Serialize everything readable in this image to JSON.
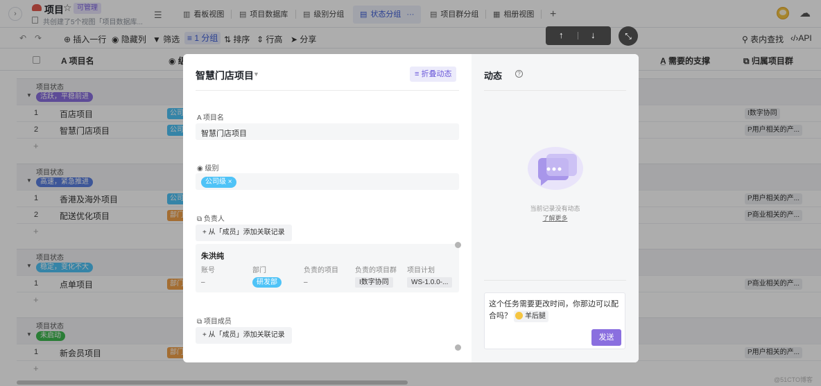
{
  "app": {
    "title": "项目",
    "badge": "可管理",
    "description": "共创建了5个视图「项目数据库...",
    "views": [
      {
        "label": "看板视图"
      },
      {
        "label": "项目数据库"
      },
      {
        "label": "级别分组"
      },
      {
        "label": "状态分组"
      },
      {
        "label": "项目群分组"
      },
      {
        "label": "相册视图"
      }
    ]
  },
  "toolbar": {
    "insert_row": "插入一行",
    "hide_cols": "隐藏列",
    "filter": "筛选",
    "group": "1 分组",
    "sort": "排序",
    "row_height": "行高",
    "share": "分享",
    "find": "表内查找",
    "api": "API"
  },
  "table": {
    "headers": {
      "name": "项目名",
      "level": "级",
      "support": "需要的支撑",
      "project_group": "归属项目群"
    },
    "group_label": "项目状态",
    "groups": [
      {
        "status": "活跃，平稳前进",
        "color": "#8a6fdf",
        "rows": [
          {
            "num": "1",
            "name": "百店项目",
            "level": "公司级",
            "level_color": "#4fc3f7",
            "pg": "I数字协同"
          },
          {
            "num": "2",
            "name": "智慧门店项目",
            "level": "公司级",
            "level_color": "#4fc3f7",
            "pg": "P用户相关的产..."
          }
        ]
      },
      {
        "status": "高速，紧急推进",
        "color": "#5b7fe0",
        "rows": [
          {
            "num": "1",
            "name": "香港及海外项目",
            "level": "公司级",
            "level_color": "#4fc3f7",
            "pg": "P用户相关的产..."
          },
          {
            "num": "2",
            "name": "配送优化项目",
            "level": "部门级",
            "level_color": "#f0a14a",
            "pg": "P商业相关的产..."
          }
        ]
      },
      {
        "status": "稳定，变化不大",
        "color": "#4fc3f7",
        "rows": [
          {
            "num": "1",
            "name": "点单项目",
            "level": "部门级",
            "level_color": "#f0a14a",
            "pg": "P商业相关的产..."
          }
        ]
      },
      {
        "status": "未启动",
        "color": "#3fb950",
        "rows": [
          {
            "num": "1",
            "name": "新会员项目",
            "level": "部门级",
            "level_color": "#f0a14a",
            "pg": "P用户相关的产..."
          }
        ]
      }
    ]
  },
  "modal": {
    "title": "智慧门店项目",
    "fold_btn": "折叠动态",
    "fields": {
      "name_label": "项目名",
      "name_value": "智慧门店项目",
      "level_label": "级别",
      "level_value": "公司级",
      "owner_label": "负责人",
      "owner_add": "从「成员」添加关联记录",
      "member_label": "项目成员",
      "member_add": "从「成员」添加关联记录"
    },
    "card": {
      "name": "朱洪纯",
      "cols": [
        "账号",
        "部门",
        "负责的项目",
        "负责的项目群",
        "项目计划"
      ],
      "account": "–",
      "dept": "研发部",
      "owned_projects": "–",
      "owned_group": "I数字协同",
      "plan": "WS-1.0.0-..."
    },
    "activity": {
      "title": "动态",
      "empty": "当前记录没有动态",
      "learn_more": "了解更多",
      "comment": "这个任务需要更改时间，你那边可以配合吗？",
      "mention": "羊后腿",
      "send": "发送"
    }
  },
  "watermark": "@51CTO博客"
}
